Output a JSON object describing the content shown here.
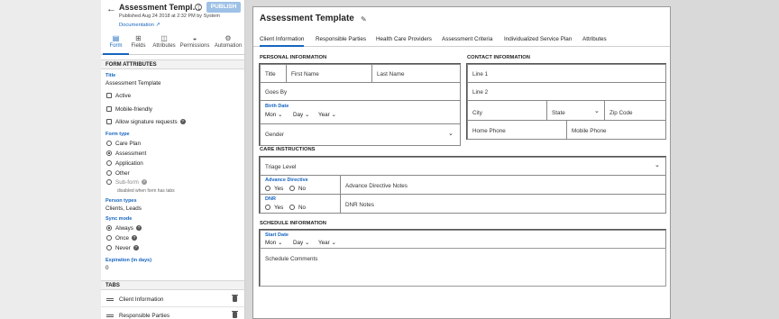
{
  "header": {
    "form_name": "Assessment Templ…",
    "publish_label": "PUBLISH",
    "published_line": "Published Aug 24 2018 at 2:32 PM by System",
    "documentation_link": "Documentation ↗"
  },
  "toolbar": [
    {
      "label": "Form",
      "icon": "document-icon",
      "glyph": "▤"
    },
    {
      "label": "Fields",
      "icon": "fields-icon",
      "glyph": "⊞"
    },
    {
      "label": "Attributes",
      "icon": "attributes-icon",
      "glyph": "◫"
    },
    {
      "label": "Permissions",
      "icon": "permissions-icon",
      "glyph": "◒"
    },
    {
      "label": "Automation",
      "icon": "automation-icon",
      "glyph": "⚙"
    }
  ],
  "form_attributes": {
    "section_title": "FORM ATTRIBUTES",
    "title_label": "Title",
    "title_value": "Assessment Template",
    "active_label": "Active",
    "mobile_label": "Mobile-friendly",
    "signature_label": "Allow signature requests",
    "form_type_label": "Form type",
    "form_types": [
      "Care Plan",
      "Assessment",
      "Application",
      "Other",
      "Sub-form"
    ],
    "form_type_selected": "Assessment",
    "subform_note": "disabled when form has tabs",
    "person_types_label": "Person types",
    "person_types_value": "Clients, Leads",
    "sync_mode_label": "Sync mode",
    "sync_modes": [
      "Always",
      "Once",
      "Never"
    ],
    "sync_selected": "Always",
    "expiration_label": "Expiration (in days)",
    "expiration_value": "0"
  },
  "tabs_section": {
    "title": "TABS",
    "items": [
      "Client Information",
      "Responsible Parties"
    ]
  },
  "canvas": {
    "title": "Assessment Template",
    "tabs": [
      "Client Information",
      "Responsible Parties",
      "Health Care Providers",
      "Assessment Criteria",
      "Individualized Service Plan",
      "Attributes"
    ],
    "personal": {
      "heading": "PERSONAL INFORMATION",
      "title": "Title",
      "first_name": "First Name",
      "last_name": "Last Name",
      "goes_by": "Goes By",
      "birth_date_label": "Birth Date",
      "month": "Mon",
      "day": "Day",
      "year": "Year",
      "gender": "Gender"
    },
    "contact": {
      "heading": "CONTACT INFORMATION",
      "line1": "Line 1",
      "line2": "Line 2",
      "city": "City",
      "state": "State",
      "zip": "Zip Code",
      "home_phone": "Home Phone",
      "mobile_phone": "Mobile Phone"
    },
    "care": {
      "heading": "CARE INSTRUCTIONS",
      "triage": "Triage Level",
      "adv_label": "Advance Directive",
      "yes": "Yes",
      "no": "No",
      "adv_notes": "Advance Directive Notes",
      "dnr_label": "DNR",
      "dnr_notes": "DNR Notes"
    },
    "schedule": {
      "heading": "SCHEDULE INFORMATION",
      "start_label": "Start Date",
      "month": "Mon",
      "day": "Day",
      "year": "Year",
      "comments": "Schedule Comments"
    }
  }
}
